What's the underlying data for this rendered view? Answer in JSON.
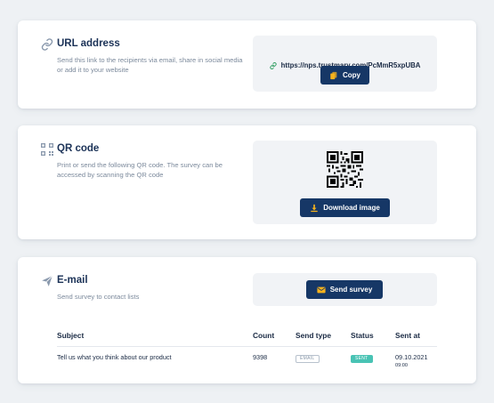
{
  "url_section": {
    "title": "URL address",
    "description": "Send this link to the recipients via email, share in social media or add it to your website",
    "link": "https://nps.trustmary.com/PcMmR5xpUBA",
    "copy_label": "Copy"
  },
  "qr_section": {
    "title": "QR code",
    "description": "Print or send the following QR code. The survey can be accessed by scanning the QR code",
    "download_label": "Download image"
  },
  "email_section": {
    "title": "E-mail",
    "description": "Send survey to contact lists",
    "send_label": "Send survey",
    "table": {
      "headers": [
        "Subject",
        "Count",
        "Send type",
        "Status",
        "Sent at"
      ],
      "rows": [
        {
          "subject": "Tell us what you think about our product",
          "count": "9398",
          "send_type": "EMAIL",
          "status": "SENT",
          "sent_date": "09.10.2021",
          "sent_time": "09:00"
        }
      ]
    }
  },
  "colors": {
    "primary_button": "#163766",
    "button_icon": "#f5b21d",
    "status_sent": "#49c3b4",
    "link_icon": "#3da36b"
  },
  "icons": {
    "url": "link-icon",
    "qr": "qr-code-icon",
    "email": "paper-plane-icon",
    "copy": "copy-icon",
    "download": "download-icon",
    "send": "envelope-icon"
  }
}
